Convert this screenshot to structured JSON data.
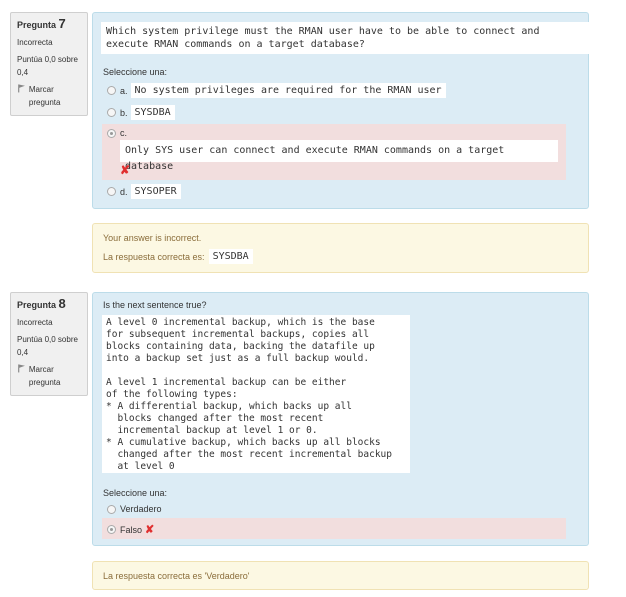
{
  "q7": {
    "label": "Pregunta",
    "number": "7",
    "state": "Incorrecta",
    "grade": "Puntúa 0,0 sobre 0,4",
    "flag": "Marcar pregunta",
    "question": "Which system privilege must the RMAN user have to be able to connect and execute RMAN commands on a target database?",
    "select_label": "Seleccione una:",
    "options": [
      {
        "letter": "a.",
        "text": "No system privileges are required for the RMAN user"
      },
      {
        "letter": "b.",
        "text": "SYSDBA"
      },
      {
        "letter": "c.",
        "text": "Only SYS user can connect and execute RMAN commands on a target database"
      },
      {
        "letter": "d.",
        "text": "SYSOPER"
      }
    ],
    "feedback_incorrect": "Your answer is incorrect.",
    "correct_prefix": "La respuesta correcta es:",
    "correct_answer": "SYSDBA"
  },
  "q8": {
    "label": "Pregunta",
    "number": "8",
    "state": "Incorrecta",
    "grade": "Puntúa 0,0 sobre 0,4",
    "flag": "Marcar pregunta",
    "question_intro": "Is the next sentence true?",
    "question_body": "A level 0 incremental backup, which is the base\nfor subsequent incremental backups, copies all\nblocks containing data, backing the datafile up\ninto a backup set just as a full backup would.\n\nA level 1 incremental backup can be either\nof the following types:\n* A differential backup, which backs up all\n  blocks changed after the most recent\n  incremental backup at level 1 or 0.\n* A cumulative backup, which backs up all blocks\n  changed after the most recent incremental backup\n  at level 0",
    "select_label": "Seleccione una:",
    "options": [
      {
        "text": "Verdadero"
      },
      {
        "text": "Falso"
      }
    ],
    "feedback": "La respuesta correcta es 'Verdadero'"
  }
}
